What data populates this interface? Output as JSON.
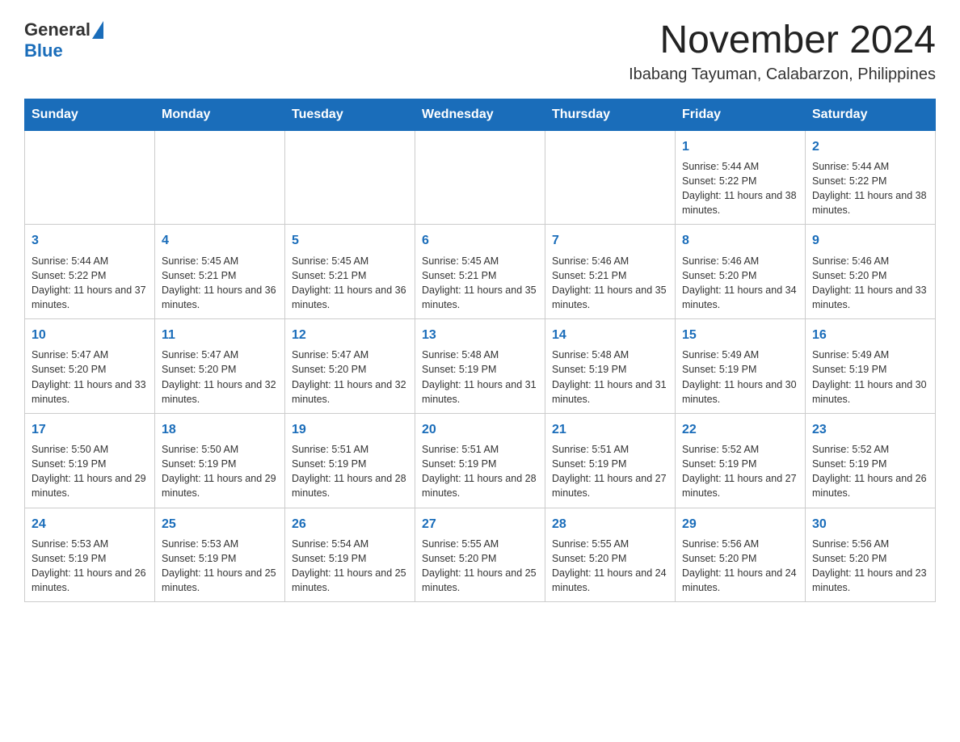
{
  "header": {
    "logo_general": "General",
    "logo_blue": "Blue",
    "month_title": "November 2024",
    "location": "Ibabang Tayuman, Calabarzon, Philippines"
  },
  "calendar": {
    "days_of_week": [
      "Sunday",
      "Monday",
      "Tuesday",
      "Wednesday",
      "Thursday",
      "Friday",
      "Saturday"
    ],
    "weeks": [
      [
        {
          "day": "",
          "info": ""
        },
        {
          "day": "",
          "info": ""
        },
        {
          "day": "",
          "info": ""
        },
        {
          "day": "",
          "info": ""
        },
        {
          "day": "",
          "info": ""
        },
        {
          "day": "1",
          "info": "Sunrise: 5:44 AM\nSunset: 5:22 PM\nDaylight: 11 hours and 38 minutes."
        },
        {
          "day": "2",
          "info": "Sunrise: 5:44 AM\nSunset: 5:22 PM\nDaylight: 11 hours and 38 minutes."
        }
      ],
      [
        {
          "day": "3",
          "info": "Sunrise: 5:44 AM\nSunset: 5:22 PM\nDaylight: 11 hours and 37 minutes."
        },
        {
          "day": "4",
          "info": "Sunrise: 5:45 AM\nSunset: 5:21 PM\nDaylight: 11 hours and 36 minutes."
        },
        {
          "day": "5",
          "info": "Sunrise: 5:45 AM\nSunset: 5:21 PM\nDaylight: 11 hours and 36 minutes."
        },
        {
          "day": "6",
          "info": "Sunrise: 5:45 AM\nSunset: 5:21 PM\nDaylight: 11 hours and 35 minutes."
        },
        {
          "day": "7",
          "info": "Sunrise: 5:46 AM\nSunset: 5:21 PM\nDaylight: 11 hours and 35 minutes."
        },
        {
          "day": "8",
          "info": "Sunrise: 5:46 AM\nSunset: 5:20 PM\nDaylight: 11 hours and 34 minutes."
        },
        {
          "day": "9",
          "info": "Sunrise: 5:46 AM\nSunset: 5:20 PM\nDaylight: 11 hours and 33 minutes."
        }
      ],
      [
        {
          "day": "10",
          "info": "Sunrise: 5:47 AM\nSunset: 5:20 PM\nDaylight: 11 hours and 33 minutes."
        },
        {
          "day": "11",
          "info": "Sunrise: 5:47 AM\nSunset: 5:20 PM\nDaylight: 11 hours and 32 minutes."
        },
        {
          "day": "12",
          "info": "Sunrise: 5:47 AM\nSunset: 5:20 PM\nDaylight: 11 hours and 32 minutes."
        },
        {
          "day": "13",
          "info": "Sunrise: 5:48 AM\nSunset: 5:19 PM\nDaylight: 11 hours and 31 minutes."
        },
        {
          "day": "14",
          "info": "Sunrise: 5:48 AM\nSunset: 5:19 PM\nDaylight: 11 hours and 31 minutes."
        },
        {
          "day": "15",
          "info": "Sunrise: 5:49 AM\nSunset: 5:19 PM\nDaylight: 11 hours and 30 minutes."
        },
        {
          "day": "16",
          "info": "Sunrise: 5:49 AM\nSunset: 5:19 PM\nDaylight: 11 hours and 30 minutes."
        }
      ],
      [
        {
          "day": "17",
          "info": "Sunrise: 5:50 AM\nSunset: 5:19 PM\nDaylight: 11 hours and 29 minutes."
        },
        {
          "day": "18",
          "info": "Sunrise: 5:50 AM\nSunset: 5:19 PM\nDaylight: 11 hours and 29 minutes."
        },
        {
          "day": "19",
          "info": "Sunrise: 5:51 AM\nSunset: 5:19 PM\nDaylight: 11 hours and 28 minutes."
        },
        {
          "day": "20",
          "info": "Sunrise: 5:51 AM\nSunset: 5:19 PM\nDaylight: 11 hours and 28 minutes."
        },
        {
          "day": "21",
          "info": "Sunrise: 5:51 AM\nSunset: 5:19 PM\nDaylight: 11 hours and 27 minutes."
        },
        {
          "day": "22",
          "info": "Sunrise: 5:52 AM\nSunset: 5:19 PM\nDaylight: 11 hours and 27 minutes."
        },
        {
          "day": "23",
          "info": "Sunrise: 5:52 AM\nSunset: 5:19 PM\nDaylight: 11 hours and 26 minutes."
        }
      ],
      [
        {
          "day": "24",
          "info": "Sunrise: 5:53 AM\nSunset: 5:19 PM\nDaylight: 11 hours and 26 minutes."
        },
        {
          "day": "25",
          "info": "Sunrise: 5:53 AM\nSunset: 5:19 PM\nDaylight: 11 hours and 25 minutes."
        },
        {
          "day": "26",
          "info": "Sunrise: 5:54 AM\nSunset: 5:19 PM\nDaylight: 11 hours and 25 minutes."
        },
        {
          "day": "27",
          "info": "Sunrise: 5:55 AM\nSunset: 5:20 PM\nDaylight: 11 hours and 25 minutes."
        },
        {
          "day": "28",
          "info": "Sunrise: 5:55 AM\nSunset: 5:20 PM\nDaylight: 11 hours and 24 minutes."
        },
        {
          "day": "29",
          "info": "Sunrise: 5:56 AM\nSunset: 5:20 PM\nDaylight: 11 hours and 24 minutes."
        },
        {
          "day": "30",
          "info": "Sunrise: 5:56 AM\nSunset: 5:20 PM\nDaylight: 11 hours and 23 minutes."
        }
      ]
    ]
  }
}
